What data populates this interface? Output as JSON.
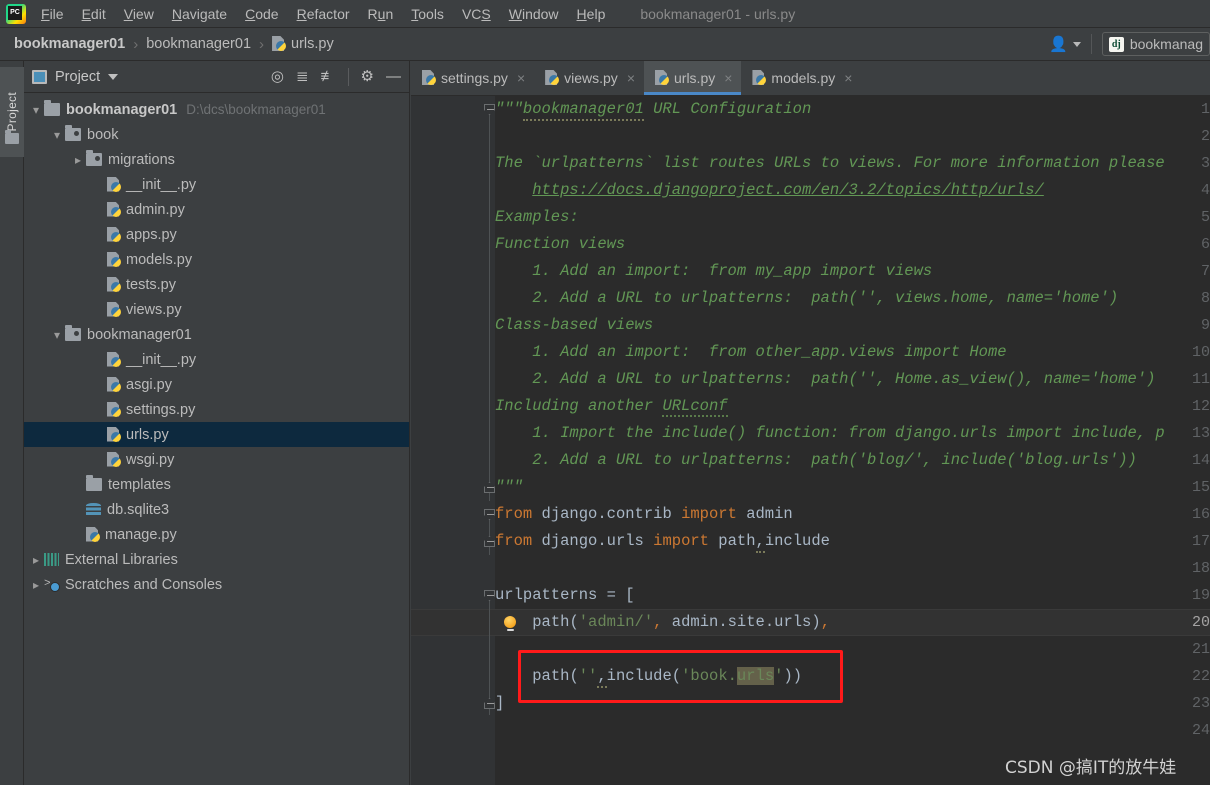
{
  "app": {
    "logo": "pycharm-logo",
    "window_title": "bookmanager01 - urls.py"
  },
  "menubar": {
    "items": [
      {
        "label": "File",
        "mnemonic": "F"
      },
      {
        "label": "Edit",
        "mnemonic": "E"
      },
      {
        "label": "View",
        "mnemonic": "V"
      },
      {
        "label": "Navigate",
        "mnemonic": "N"
      },
      {
        "label": "Code",
        "mnemonic": "C"
      },
      {
        "label": "Refactor",
        "mnemonic": "R"
      },
      {
        "label": "Run",
        "mnemonic": "R"
      },
      {
        "label": "Tools",
        "mnemonic": "T"
      },
      {
        "label": "VCS",
        "mnemonic": "V"
      },
      {
        "label": "Window",
        "mnemonic": "W"
      },
      {
        "label": "Help",
        "mnemonic": "H"
      }
    ]
  },
  "navbar": {
    "breadcrumbs": [
      "bookmanager01",
      "bookmanager01",
      "urls.py"
    ],
    "separator": "›",
    "file_icon": "python-file-icon",
    "user_icon": "user-avatar-icon",
    "run_config": {
      "icon": "django-icon",
      "label": "bookmanag"
    }
  },
  "toolstrip": {
    "project_tab_label": "Project",
    "project_tab_icon": "folder-icon"
  },
  "project_panel": {
    "title": "Project",
    "title_icon": "project-view-icon",
    "dropdown_icon": "chevron-down-icon",
    "tools": [
      {
        "name": "locate-icon",
        "glyph": "⊕"
      },
      {
        "name": "expand-all-icon",
        "glyph": "≡"
      },
      {
        "name": "collapse-all-icon",
        "glyph": "≡"
      },
      {
        "name": "settings-gear-icon",
        "glyph": "⚙"
      },
      {
        "name": "hide-panel-icon",
        "glyph": "—"
      }
    ],
    "tree": [
      {
        "label": "bookmanager01",
        "path": "D:\\dcs\\bookmanager01",
        "icon": "folder-icon",
        "twist": "open",
        "indent": 0,
        "bold": true,
        "selected": false
      },
      {
        "label": "book",
        "path": "",
        "icon": "folder-src-icon",
        "twist": "open",
        "indent": 1,
        "bold": false,
        "selected": false
      },
      {
        "label": "migrations",
        "path": "",
        "icon": "folder-src-icon",
        "twist": "closed",
        "indent": 2,
        "bold": false,
        "selected": false
      },
      {
        "label": "__init__.py",
        "path": "",
        "icon": "python-file-icon",
        "twist": "none",
        "indent": 3,
        "bold": false,
        "selected": false
      },
      {
        "label": "admin.py",
        "path": "",
        "icon": "python-file-icon",
        "twist": "none",
        "indent": 3,
        "bold": false,
        "selected": false
      },
      {
        "label": "apps.py",
        "path": "",
        "icon": "python-file-icon",
        "twist": "none",
        "indent": 3,
        "bold": false,
        "selected": false
      },
      {
        "label": "models.py",
        "path": "",
        "icon": "python-file-icon",
        "twist": "none",
        "indent": 3,
        "bold": false,
        "selected": false
      },
      {
        "label": "tests.py",
        "path": "",
        "icon": "python-file-icon",
        "twist": "none",
        "indent": 3,
        "bold": false,
        "selected": false
      },
      {
        "label": "views.py",
        "path": "",
        "icon": "python-file-icon",
        "twist": "none",
        "indent": 3,
        "bold": false,
        "selected": false
      },
      {
        "label": "bookmanager01",
        "path": "",
        "icon": "folder-src-icon",
        "twist": "open",
        "indent": 1,
        "bold": false,
        "selected": false
      },
      {
        "label": "__init__.py",
        "path": "",
        "icon": "python-file-icon",
        "twist": "none",
        "indent": 3,
        "bold": false,
        "selected": false
      },
      {
        "label": "asgi.py",
        "path": "",
        "icon": "python-file-icon",
        "twist": "none",
        "indent": 3,
        "bold": false,
        "selected": false
      },
      {
        "label": "settings.py",
        "path": "",
        "icon": "python-file-icon",
        "twist": "none",
        "indent": 3,
        "bold": false,
        "selected": false
      },
      {
        "label": "urls.py",
        "path": "",
        "icon": "python-file-icon",
        "twist": "none",
        "indent": 3,
        "bold": false,
        "selected": true
      },
      {
        "label": "wsgi.py",
        "path": "",
        "icon": "python-file-icon",
        "twist": "none",
        "indent": 3,
        "bold": false,
        "selected": false
      },
      {
        "label": "templates",
        "path": "",
        "icon": "folder-icon",
        "twist": "none",
        "indent": 2,
        "bold": false,
        "selected": false
      },
      {
        "label": "db.sqlite3",
        "path": "",
        "icon": "database-icon",
        "twist": "none",
        "indent": 2,
        "bold": false,
        "selected": false
      },
      {
        "label": "manage.py",
        "path": "",
        "icon": "python-file-icon",
        "twist": "none",
        "indent": 2,
        "bold": false,
        "selected": false
      },
      {
        "label": "External Libraries",
        "path": "",
        "icon": "libraries-icon",
        "twist": "closed",
        "indent": 0,
        "bold": false,
        "selected": false
      },
      {
        "label": "Scratches and Consoles",
        "path": "",
        "icon": "scratches-icon",
        "twist": "closed",
        "indent": 0,
        "bold": false,
        "selected": false
      }
    ]
  },
  "editor": {
    "tabs": [
      {
        "label": "settings.py",
        "icon": "python-file-icon",
        "close": "×",
        "active": false
      },
      {
        "label": "views.py",
        "icon": "python-file-icon",
        "close": "×",
        "active": false
      },
      {
        "label": "urls.py",
        "icon": "python-file-icon",
        "close": "×",
        "active": true
      },
      {
        "label": "models.py",
        "icon": "python-file-icon",
        "close": "×",
        "active": false
      }
    ],
    "current_line": 20,
    "line_numbers": [
      1,
      2,
      3,
      4,
      5,
      6,
      7,
      8,
      9,
      10,
      11,
      12,
      13,
      14,
      15,
      16,
      17,
      18,
      19,
      20,
      21,
      22,
      23,
      24
    ],
    "code_lines": [
      {
        "n": 1,
        "text": "\"\"\"bookmanager01 URL Configuration"
      },
      {
        "n": 2,
        "text": ""
      },
      {
        "n": 3,
        "text": "The `urlpatterns` list routes URLs to views. For more information please"
      },
      {
        "n": 4,
        "text": "    https://docs.djangoproject.com/en/3.2/topics/http/urls/"
      },
      {
        "n": 5,
        "text": "Examples:"
      },
      {
        "n": 6,
        "text": "Function views"
      },
      {
        "n": 7,
        "text": "    1. Add an import:  from my_app import views"
      },
      {
        "n": 8,
        "text": "    2. Add a URL to urlpatterns:  path('', views.home, name='home')"
      },
      {
        "n": 9,
        "text": "Class-based views"
      },
      {
        "n": 10,
        "text": "    1. Add an import:  from other_app.views import Home"
      },
      {
        "n": 11,
        "text": "    2. Add a URL to urlpatterns:  path('', Home.as_view(), name='home')"
      },
      {
        "n": 12,
        "text": "Including another URLconf"
      },
      {
        "n": 13,
        "text": "    1. Import the include() function: from django.urls import include, p"
      },
      {
        "n": 14,
        "text": "    2. Add a URL to urlpatterns:  path('blog/', include('blog.urls'))"
      },
      {
        "n": 15,
        "text": "\"\"\""
      },
      {
        "n": 16,
        "text": "from django.contrib import admin"
      },
      {
        "n": 17,
        "text": "from django.urls import path,include"
      },
      {
        "n": 18,
        "text": ""
      },
      {
        "n": 19,
        "text": "urlpatterns = ["
      },
      {
        "n": 20,
        "text": "    path('admin/', admin.site.urls),"
      },
      {
        "n": 21,
        "text": ""
      },
      {
        "n": 22,
        "text": "    path('',include('book.urls'))"
      },
      {
        "n": 23,
        "text": "]"
      },
      {
        "n": 24,
        "text": ""
      }
    ],
    "inspection_bulb": "intention-bulb-icon",
    "highlighted_token": "urls",
    "annotation_box": "red-highlight-rectangle"
  },
  "colors": {
    "accent_tab": "#4a88c7",
    "selection": "#0d293e",
    "annotation": "#ff1a1a",
    "docstring": "#629755",
    "keyword": "#cc7832",
    "string": "#6a8759",
    "identifier": "#a9b7c6",
    "token_highlight": "#64614a",
    "editor_bg": "#2b2b2b",
    "panel_bg": "#3c3f41"
  },
  "watermark": {
    "text": "CSDN @搞IT的放牛娃"
  }
}
